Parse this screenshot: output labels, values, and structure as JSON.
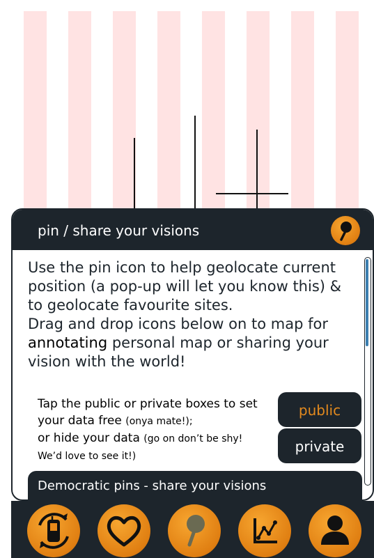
{
  "panel": {
    "title": "pin / share your visions",
    "description_1": "Use the pin icon to help geolocate current position (a pop-up will let you know this) & to geolocate favourite sites.",
    "description_2a": "Drag and drop icons below on to map for",
    "description_2b": "annotating",
    "description_2c": " personal map or sharing your vision with the world!",
    "tap_line_1": "Tap the public or private boxes to set your data free",
    "tap_line_1_small": "(onya mate!);",
    "tap_line_2": "or hide your data",
    "tap_line_2_small": "(go on don’t be shy! We’d love to see it!)",
    "public_label": "public",
    "private_label": "private",
    "footer_label": "Democratic pins -  share your visions"
  },
  "toolbar": {
    "icons": [
      "sync-phone-icon",
      "heart-icon",
      "pin-icon",
      "chart-icon",
      "user-icon"
    ]
  },
  "colors": {
    "dark": "#1d252c",
    "orange": "#e8891a",
    "stripe": "#ffe3e3",
    "scroll_thumb": "#3c7fb0"
  }
}
